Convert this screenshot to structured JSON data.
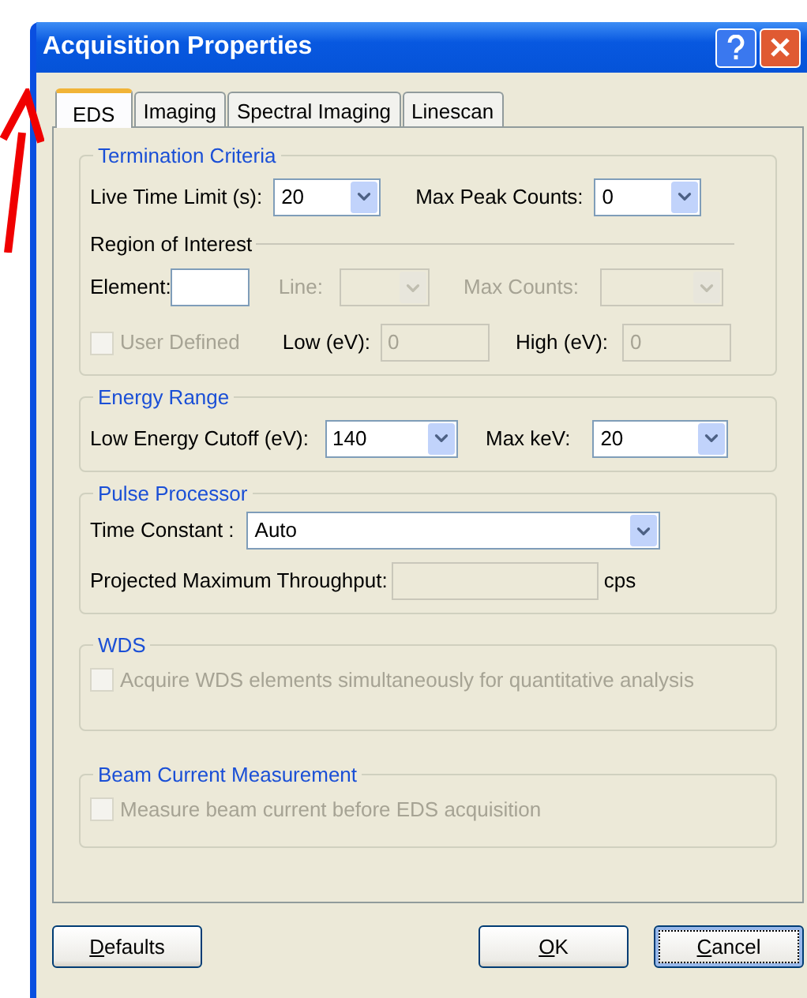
{
  "window": {
    "title": "Acquisition Properties"
  },
  "tabs": [
    {
      "label": "EDS",
      "selected": true
    },
    {
      "label": "Imaging",
      "selected": false
    },
    {
      "label": "Spectral Imaging",
      "selected": false
    },
    {
      "label": "Linescan",
      "selected": false
    }
  ],
  "termination_criteria": {
    "title": "Termination Criteria",
    "live_time_limit": {
      "label": "Live Time Limit (s):",
      "value": "20",
      "disabled": false
    },
    "max_peak_counts": {
      "label": "Max Peak Counts:",
      "value": "0",
      "disabled": false
    },
    "region_of_interest": {
      "title": "Region of Interest",
      "element": {
        "label": "Element:",
        "disabled": false
      },
      "line": {
        "label": "Line:",
        "disabled": true
      },
      "max_counts": {
        "label": "Max Counts:",
        "disabled": true
      },
      "user_defined": {
        "label": "User Defined",
        "checked": false,
        "disabled": true
      },
      "low": {
        "label": "Low (eV):",
        "value": "0",
        "disabled": true
      },
      "high": {
        "label": "High (eV):",
        "value": "0",
        "disabled": true
      }
    }
  },
  "energy_range": {
    "title": "Energy Range",
    "low_energy_cutoff": {
      "label": "Low Energy Cutoff (eV):",
      "value": "140",
      "disabled": false
    },
    "max_kev": {
      "label": "Max keV:",
      "value": "20",
      "disabled": false
    }
  },
  "pulse_processor": {
    "title": "Pulse Processor",
    "time_constant": {
      "label": "Time Constant :",
      "value": "Auto",
      "disabled": false
    },
    "throughput": {
      "label": "Projected Maximum Throughput:",
      "unit": "cps",
      "disabled": true
    }
  },
  "wds": {
    "title": "WDS",
    "acquire": {
      "label": "Acquire WDS elements simultaneously for quantitative analysis",
      "checked": false,
      "disabled": true
    }
  },
  "beam_current": {
    "title": "Beam Current Measurement",
    "measure": {
      "label": "Measure beam current before EDS acquisition",
      "checked": false,
      "disabled": true
    }
  },
  "buttons": [
    {
      "label": "Defaults",
      "kind": "left",
      "focused": false
    },
    {
      "label": "OK",
      "kind": "right",
      "focused": false
    },
    {
      "label": "Cancel",
      "kind": "right",
      "focused": true
    }
  ]
}
